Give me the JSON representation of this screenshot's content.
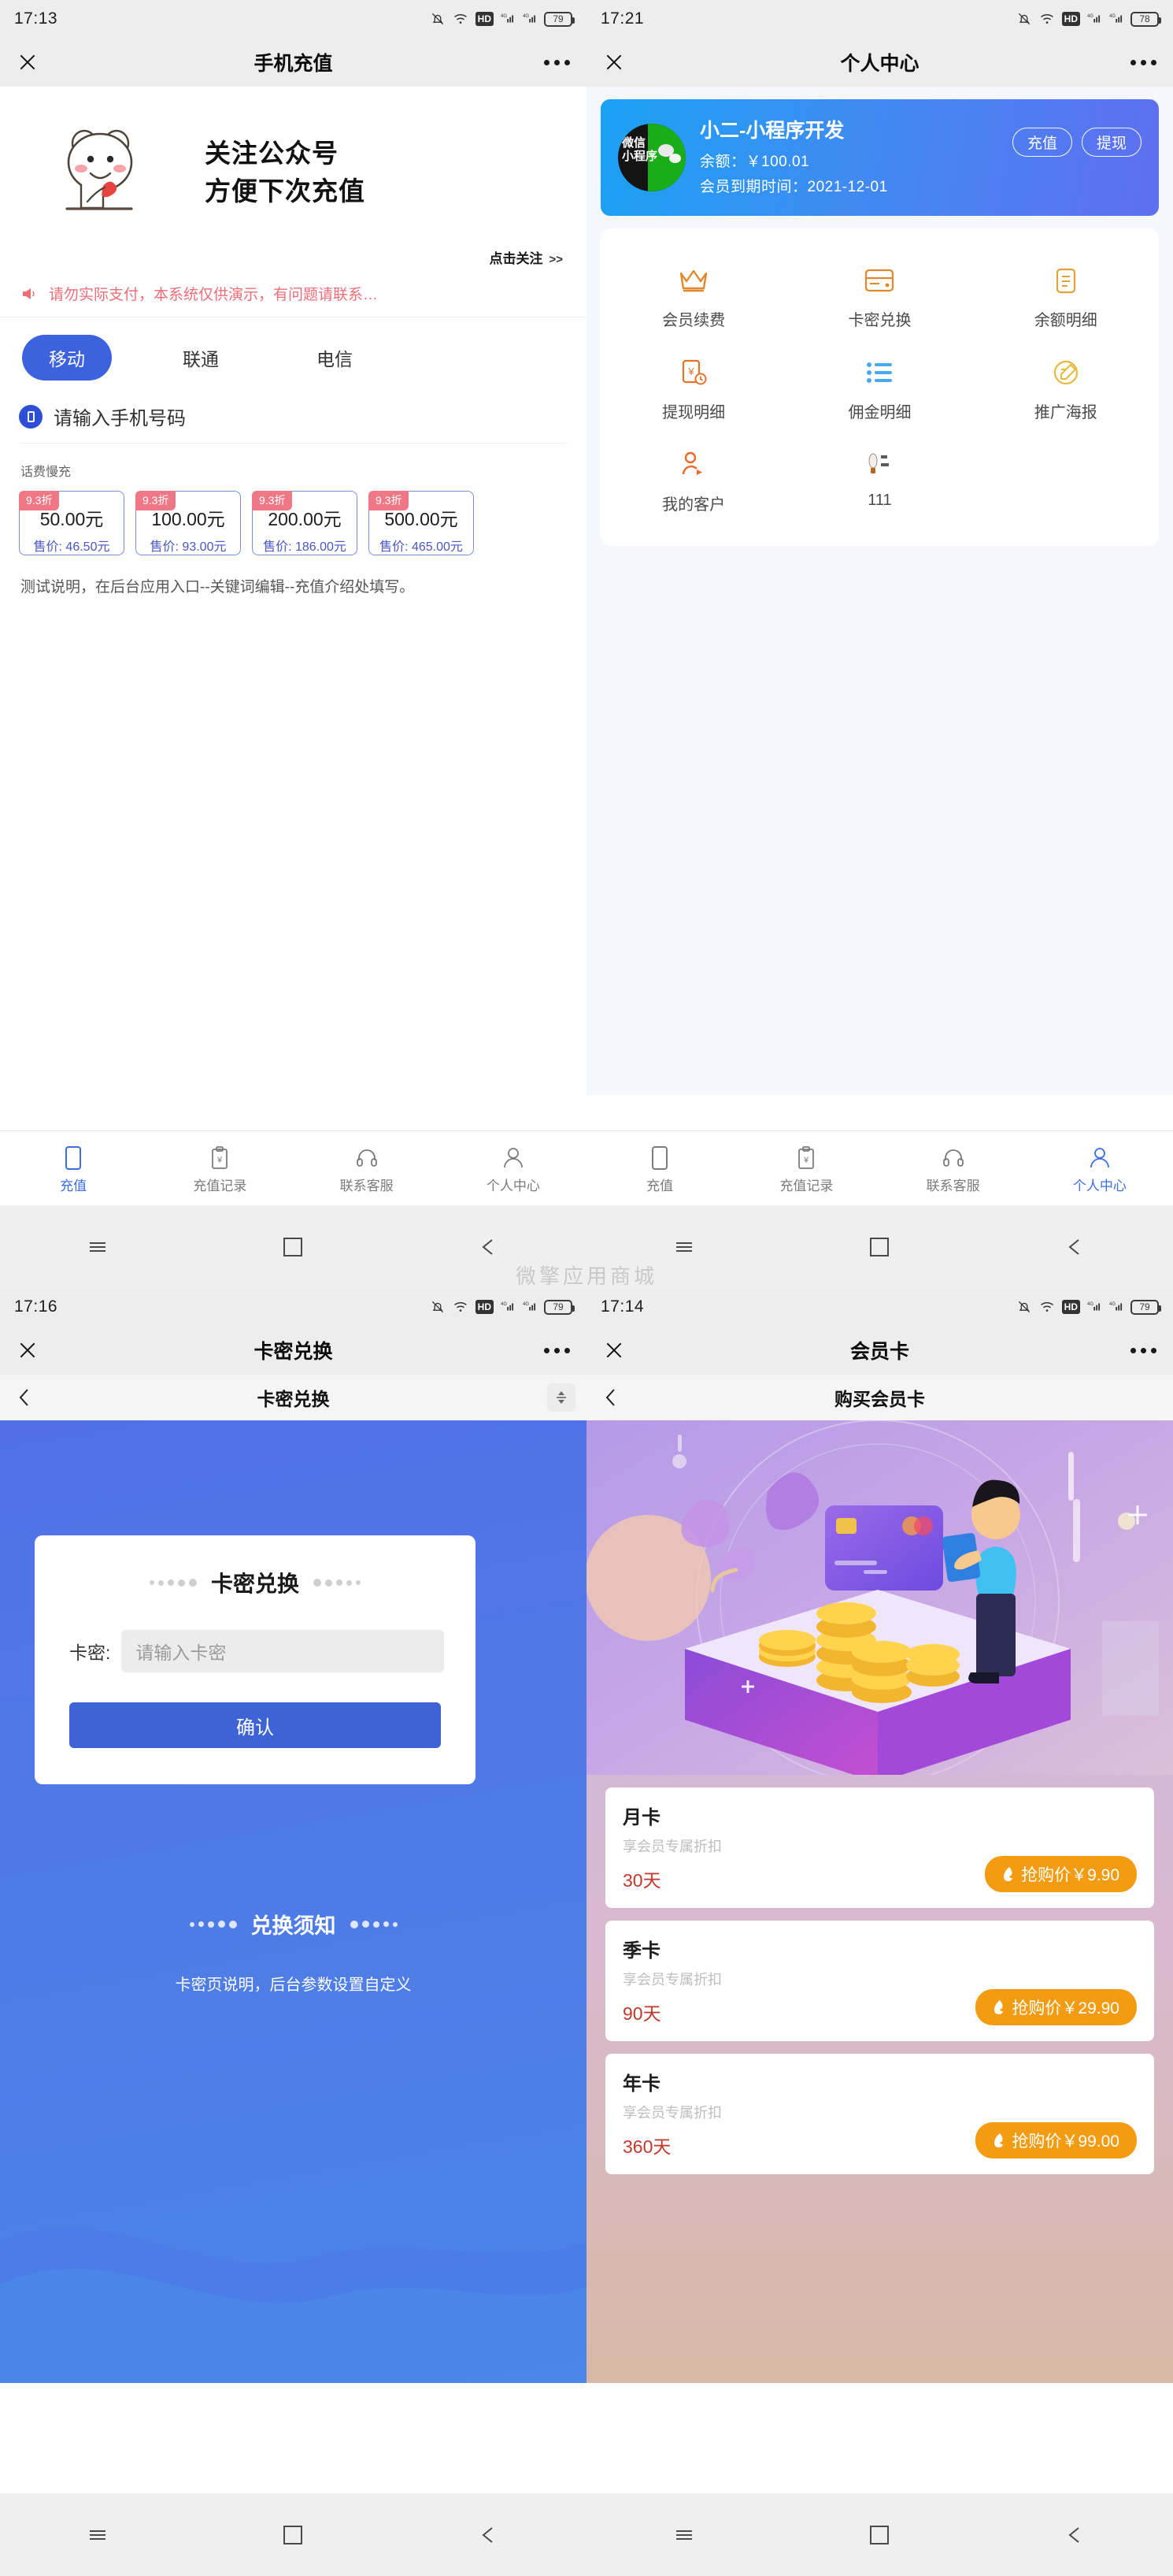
{
  "panels": {
    "recharge": {
      "status": {
        "time": "17:13",
        "battery": "79"
      },
      "nav": {
        "title": "手机充值",
        "close": "✕"
      },
      "hero": {
        "line1": "关注公众号",
        "line2": "方便下次充值",
        "follow": "点击关注",
        "follow_chevron": ">>"
      },
      "notice": "请勿实际支付，本系统仅供演示，有问题请联系…",
      "operators": [
        {
          "label": "移动",
          "active": true
        },
        {
          "label": "联通",
          "active": false
        },
        {
          "label": "电信",
          "active": false
        }
      ],
      "phone_placeholder": "请输入手机号码",
      "section_label": "话费慢充",
      "cards": [
        {
          "discount": "9.3折",
          "face": "50.00元",
          "sale": "售价: 46.50元"
        },
        {
          "discount": "9.3折",
          "face": "100.00元",
          "sale": "售价: 93.00元"
        },
        {
          "discount": "9.3折",
          "face": "200.00元",
          "sale": "售价: 186.00元"
        },
        {
          "discount": "9.3折",
          "face": "500.00元",
          "sale": "售价: 465.00元"
        }
      ],
      "description": "测试说明，在后台应用入口--关键词编辑--充值介绍处填写。",
      "tabs": [
        {
          "label": "充值",
          "icon": "phone-icon",
          "active": true
        },
        {
          "label": "充值记录",
          "icon": "receipt-icon",
          "active": false
        },
        {
          "label": "联系客服",
          "icon": "headset-icon",
          "active": false
        },
        {
          "label": "个人中心",
          "icon": "person-icon",
          "active": false
        }
      ]
    },
    "profile": {
      "status": {
        "time": "17:21",
        "battery": "78"
      },
      "nav": {
        "title": "个人中心",
        "close": "✕"
      },
      "account": {
        "avatar_line1": "微信",
        "avatar_line2": "小程序",
        "name": "小二-小程序开发",
        "balance": "余额：￥100.01",
        "expiry": "会员到期时间：2021-12-01",
        "btn_recharge": "充值",
        "btn_withdraw": "提现"
      },
      "menu": [
        {
          "label": "会员续费",
          "icon": "crown-icon",
          "color": "#e3872b"
        },
        {
          "label": "卡密兑换",
          "icon": "card-icon",
          "color": "#e3872b"
        },
        {
          "label": "余额明细",
          "icon": "note-icon",
          "color": "#e0a33a"
        },
        {
          "label": "提现明细",
          "icon": "yen-clock-icon",
          "color": "#e3722b"
        },
        {
          "label": "佣金明细",
          "icon": "list-icon",
          "color": "#4aa8f0"
        },
        {
          "label": "推广海报",
          "icon": "poster-icon",
          "color": "#e8b93c"
        },
        {
          "label": "我的客户",
          "icon": "megaphone-person-icon",
          "color": "#ef6a28"
        },
        {
          "label": "111",
          "icon": "custom-image-icon",
          "color": "#b5651d"
        }
      ],
      "tabs": [
        {
          "label": "充值",
          "icon": "phone-icon",
          "active": false
        },
        {
          "label": "充值记录",
          "icon": "receipt-icon",
          "active": false
        },
        {
          "label": "联系客服",
          "icon": "headset-icon",
          "active": false
        },
        {
          "label": "个人中心",
          "icon": "person-icon",
          "active": true
        }
      ]
    },
    "redeem": {
      "status": {
        "time": "17:16",
        "battery": "79"
      },
      "nav": {
        "title": "卡密兑换",
        "close": "✕"
      },
      "subnav": {
        "title": "卡密兑换",
        "back": "‹"
      },
      "card": {
        "title": "卡密兑换",
        "label": "卡密:",
        "placeholder": "请输入卡密",
        "submit": "确认"
      },
      "notice_title": "兑换须知",
      "notice_body": "卡密页说明，后台参数设置自定义"
    },
    "member": {
      "status": {
        "time": "17:14",
        "battery": "79"
      },
      "nav": {
        "title": "会员卡",
        "close": "✕"
      },
      "subnav": {
        "title": "购买会员卡",
        "back": "‹"
      },
      "plans": [
        {
          "name": "月卡",
          "sub": "享会员专属折扣",
          "days": "30天",
          "price": "抢购价￥9.90"
        },
        {
          "name": "季卡",
          "sub": "享会员专属折扣",
          "days": "90天",
          "price": "抢购价￥29.90"
        },
        {
          "name": "年卡",
          "sub": "享会员专属折扣",
          "days": "360天",
          "price": "抢购价￥99.00"
        }
      ]
    }
  },
  "watermark": "微擎应用商城",
  "colors": {
    "brand_blue": "#3c62e0",
    "accent_red": "#ef6d78",
    "orange": "#f39c12",
    "tab_active": "#3b6fe0"
  }
}
